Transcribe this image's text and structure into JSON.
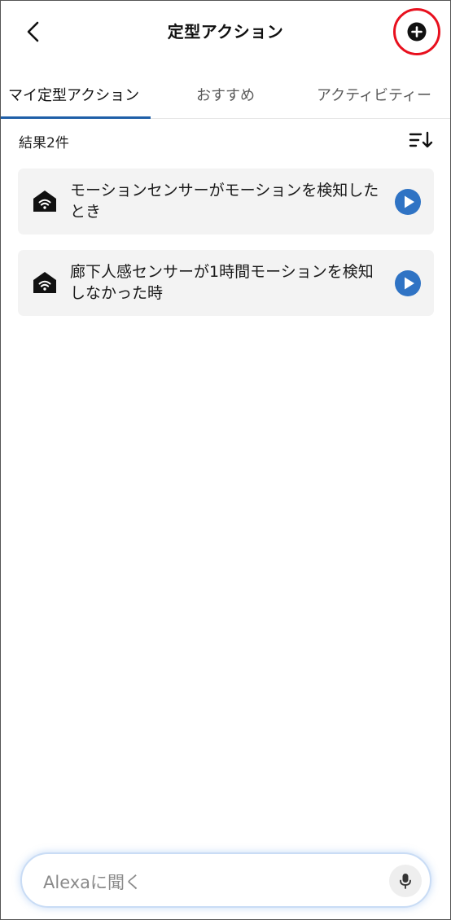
{
  "header": {
    "title": "定型アクション"
  },
  "tabs": [
    {
      "label": "マイ定型アクション",
      "active": true
    },
    {
      "label": "おすすめ",
      "active": false
    },
    {
      "label": "アクティビティー",
      "active": false
    }
  ],
  "results": {
    "count_label": "結果2件"
  },
  "routines": [
    {
      "label": "モーションセンサーがモーションを検知したとき",
      "icon": "smart-home-icon"
    },
    {
      "label": "廊下人感センサーが1時間モーションを検知しなかった時",
      "icon": "smart-home-icon"
    }
  ],
  "alexa_input": {
    "placeholder": "Alexaに聞く"
  },
  "colors": {
    "accent_blue": "#1f5fa8",
    "play_blue": "#2f73c4",
    "highlight_red": "#e8101e",
    "card_bg": "#f3f3f3"
  }
}
